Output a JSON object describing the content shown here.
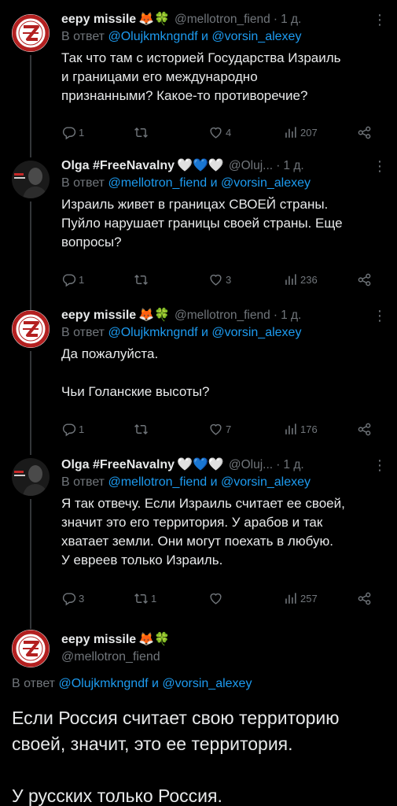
{
  "tweets": [
    {
      "name": "eepy missile",
      "emoji": "🦊🍀",
      "handle": "@mellotron_fiend",
      "time": "1 д.",
      "reply_prefix": "В ответ",
      "reply_mention1": "@Olujkmkngndf",
      "reply_and": "и",
      "reply_mention2": "@vorsin_alexey",
      "text": "Так что там с историей Государства Израиль\nи границами его международно\nпризнанными? Какое-то противоречие?",
      "replies": "1",
      "retweets": "",
      "likes": "4",
      "views": "207"
    },
    {
      "name": "Olga #FreeNavalny",
      "emoji": "🤍💙🤍",
      "handle": "@Oluj...",
      "time": "1 д.",
      "reply_prefix": "В ответ",
      "reply_mention1": "@mellotron_fiend",
      "reply_and": "и",
      "reply_mention2": "@vorsin_alexey",
      "text": "Израиль живет в границах СВОЕЙ страны.\nПуйло нарушает границы своей страны. Еще\nвопросы?",
      "replies": "1",
      "retweets": "",
      "likes": "3",
      "views": "236"
    },
    {
      "name": "eepy missile",
      "emoji": "🦊🍀",
      "handle": "@mellotron_fiend",
      "time": "1 д.",
      "reply_prefix": "В ответ",
      "reply_mention1": "@Olujkmkngndf",
      "reply_and": "и",
      "reply_mention2": "@vorsin_alexey",
      "text": "Да пожалуйста.\n\nЧьи Голанские высоты?",
      "replies": "1",
      "retweets": "",
      "likes": "7",
      "views": "176"
    },
    {
      "name": "Olga #FreeNavalny",
      "emoji": "🤍💙🤍",
      "handle": "@Oluj...",
      "time": "1 д.",
      "reply_prefix": "В ответ",
      "reply_mention1": "@mellotron_fiend",
      "reply_and": "и",
      "reply_mention2": "@vorsin_alexey",
      "text": "Я так отвечу. Если Израиль считает ее своей,\nзначит это его территория. У арабов и так\nхватает земли. Они могут поехать в любую.\nУ евреев только Израиль.",
      "replies": "3",
      "retweets": "1",
      "likes": "",
      "views": "257"
    }
  ],
  "main_tweet": {
    "name": "eepy missile",
    "emoji": "🦊🍀",
    "handle": "@mellotron_fiend",
    "reply_prefix": "В ответ",
    "reply_mention1": "@Olujkmkngndf",
    "reply_and": "и",
    "reply_mention2": "@vorsin_alexey",
    "text": "Если Россия считает свою территорию\nсвоей, значит, это ее территория.\n\nУ русских только Россия."
  },
  "colors": {
    "background": "#000000",
    "text": "#e7e9ea",
    "secondary": "#71767b",
    "link": "#1d9bf0"
  },
  "icons": [
    "reply-icon",
    "retweet-icon",
    "like-icon",
    "views-icon",
    "share-icon",
    "more-icon"
  ]
}
